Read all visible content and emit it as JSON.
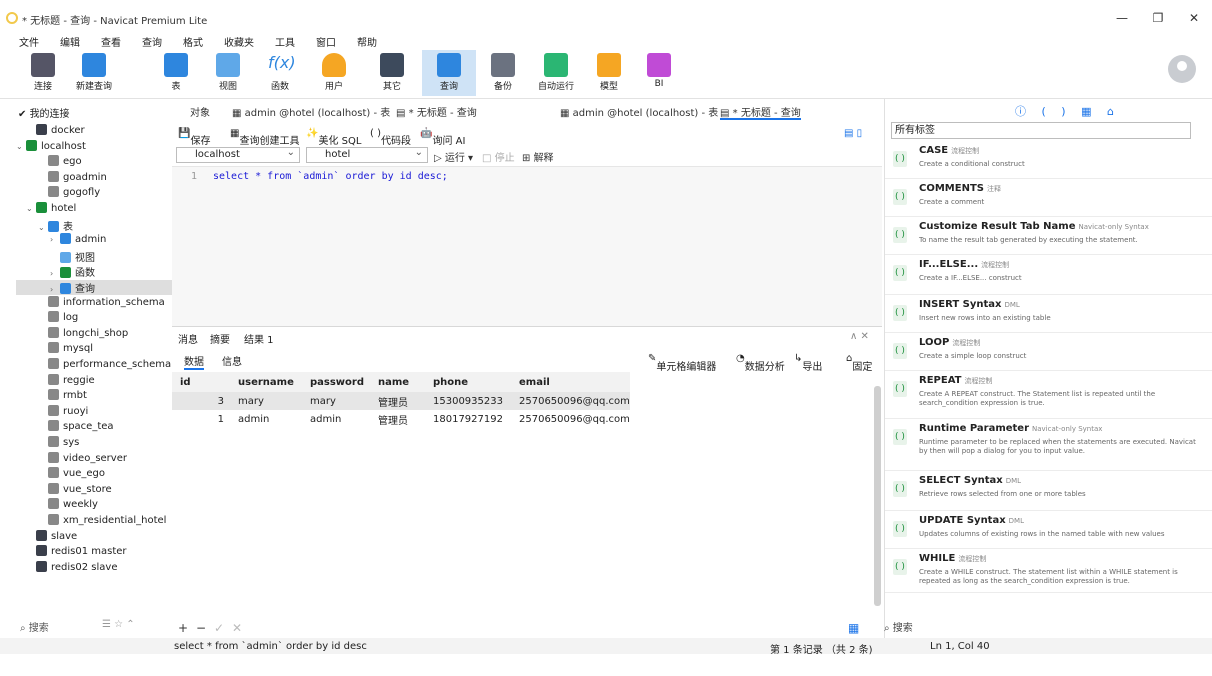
{
  "window": {
    "title": "* 无标题 - 查询 - Navicat Premium Lite"
  },
  "menu": [
    "文件",
    "编辑",
    "查看",
    "查询",
    "格式",
    "收藏夹",
    "工具",
    "窗口",
    "帮助"
  ],
  "toolbar": [
    {
      "label": "连接",
      "icon": "plug-icon"
    },
    {
      "label": "新建查询",
      "icon": "new-query-icon"
    },
    {
      "label": "表",
      "icon": "table-icon"
    },
    {
      "label": "视图",
      "icon": "view-icon"
    },
    {
      "label": "函数",
      "icon": "function-icon"
    },
    {
      "label": "用户",
      "icon": "user-icon"
    },
    {
      "label": "其它",
      "icon": "other-icon"
    },
    {
      "label": "查询",
      "icon": "query-icon"
    },
    {
      "label": "备份",
      "icon": "backup-icon"
    },
    {
      "label": "自动运行",
      "icon": "robot-icon"
    },
    {
      "label": "模型",
      "icon": "model-icon"
    },
    {
      "label": "BI",
      "icon": "bi-icon"
    }
  ],
  "nav": {
    "header": "我的连接",
    "items": [
      "docker",
      "localhost",
      "ego",
      "goadmin",
      "gogofly",
      "hotel",
      "表",
      "admin",
      "视图",
      "函数",
      "查询",
      "information_schema",
      "log",
      "longchi_shop",
      "mysql",
      "performance_schema",
      "reggie",
      "rmbt",
      "ruoyi",
      "space_tea",
      "sys",
      "video_server",
      "vue_ego",
      "vue_store",
      "weekly",
      "xm_residential_hotel",
      "slave",
      "redis01 master",
      "redis02 slave"
    ],
    "search": "搜索"
  },
  "tabs": [
    "对象",
    "admin @hotel (localhost) - 表",
    "* 无标题 - 查询",
    "admin @hotel (localhost) - 表",
    "* 无标题 - 查询"
  ],
  "editor_tools": {
    "save": "保存",
    "builder": "查询创建工具",
    "beautify": "美化 SQL",
    "snippet": "代码段",
    "ai": "询问 AI"
  },
  "connection": {
    "server": "localhost",
    "database": "hotel",
    "run": "运行",
    "stop": "停止",
    "explain": "解释"
  },
  "sql": {
    "line": "1",
    "text": "select * from `admin` order by id desc;"
  },
  "result": {
    "tabs": [
      "消息",
      "摘要",
      "结果 1"
    ],
    "subtabs": [
      "数据",
      "信息"
    ],
    "tools": [
      "单元格编辑器",
      "数据分析",
      "导出",
      "固定"
    ],
    "columns": [
      "id",
      "username",
      "password",
      "name",
      "phone",
      "email"
    ],
    "rows": [
      [
        "3",
        "mary",
        "mary",
        "管理员",
        "15300935233",
        "2570650096@qq.com"
      ],
      [
        "1",
        "admin",
        "admin",
        "管理员",
        "18017927192",
        "2570650096@qq.com"
      ]
    ]
  },
  "status": {
    "sql": "select * from `admin` order by id desc",
    "records": "第 1 条记录 （共 2 条)",
    "position": "Ln 1, Col 40"
  },
  "snippets": {
    "filter": "所有标签",
    "search": "搜索",
    "items": [
      {
        "name": "CASE",
        "tag": "流程控制",
        "desc": "Create a conditional construct"
      },
      {
        "name": "COMMENTS",
        "tag": "注释",
        "desc": "Create a comment"
      },
      {
        "name": "Customize Result Tab Name",
        "tag": "Navicat-only Syntax",
        "desc": "To name the result tab generated by executing the statement."
      },
      {
        "name": "IF...ELSE...",
        "tag": "流程控制",
        "desc": "Create a IF...ELSE... construct"
      },
      {
        "name": "INSERT Syntax",
        "tag": "DML",
        "desc": "Insert new rows into an existing table"
      },
      {
        "name": "LOOP",
        "tag": "流程控制",
        "desc": "Create a simple loop construct"
      },
      {
        "name": "REPEAT",
        "tag": "流程控制",
        "desc": "Create A REPEAT construct. The Statement list is repeated until the search_condition expression is true."
      },
      {
        "name": "Runtime Parameter",
        "tag": "Navicat-only Syntax",
        "desc": "Runtime parameter to be replaced when the statements are executed. Navicat by then will pop a dialog for you to input value."
      },
      {
        "name": "SELECT Syntax",
        "tag": "DML",
        "desc": "Retrieve rows selected from one or more tables"
      },
      {
        "name": "UPDATE Syntax",
        "tag": "DML",
        "desc": "Updates columns of existing rows in the named table with new values"
      },
      {
        "name": "WHILE",
        "tag": "流程控制",
        "desc": "Create a WHILE construct. The statement list within a WHILE statement is repeated as long as the search_condition expression is true."
      }
    ]
  },
  "colors": {
    "accent": "#1a73e8",
    "selected": "#cfe3f6",
    "green": "#1a8f3a"
  }
}
